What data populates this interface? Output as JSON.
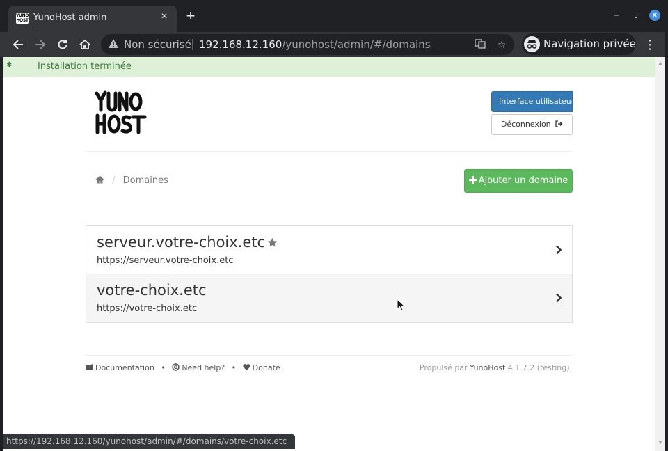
{
  "browser": {
    "tab_title": "YunoHost admin",
    "tab_favicon_text": "YUNO HOST",
    "security_label": "Non sécurisé",
    "url_host": "192.168.12.160",
    "url_path": "/yunohost/admin/#/domains",
    "private_label": "Navigation privée",
    "status_url": "https://192.168.12.160/yunohost/admin/#/domains/votre-choix.etc"
  },
  "alert": {
    "text": "Installation terminée"
  },
  "header": {
    "logo_text": "YunoHost",
    "user_interface_label": "Interface utilisateur",
    "logout_label": "Déconnexion"
  },
  "breadcrumb": {
    "current": "Domaines"
  },
  "actions": {
    "add_domain_label": "Ajouter un domaine"
  },
  "domains": [
    {
      "name": "serveur.votre-choix.etc",
      "url": "https://serveur.votre-choix.etc",
      "is_main": true
    },
    {
      "name": "votre-choix.etc",
      "url": "https://votre-choix.etc",
      "is_main": false
    }
  ],
  "footer": {
    "documentation": "Documentation",
    "need_help": "Need help?",
    "donate": "Donate",
    "powered_by": "Propulsé par",
    "brand": "YunoHost",
    "version": "4.1.7.2 (testing)."
  },
  "colors": {
    "alert_bg": "#dff0d8",
    "alert_text": "#3c763d",
    "primary": "#337ab7",
    "success": "#5cb85c",
    "browser_dark": "#202124"
  }
}
